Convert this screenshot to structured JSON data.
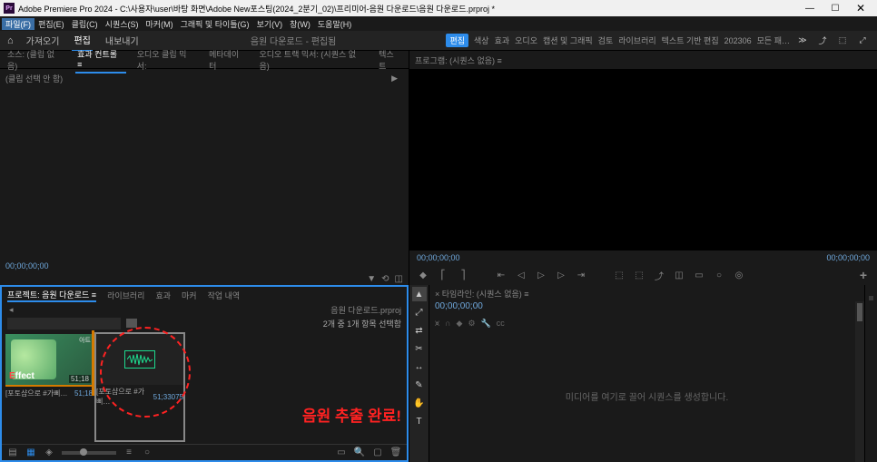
{
  "title_bar": {
    "app_icon_text": "Pr",
    "title": "Adobe Premiere Pro 2024 - C:\\사용자\\user\\바탕 화면\\Adobe New포스팅(2024_2분기_02)\\프리미어-음원 다운로드\\음원 다운로드.prproj *",
    "minimize": "—",
    "maximize": "☐",
    "close": "✕"
  },
  "menu": {
    "file": "파일(F)",
    "edit": "편집(E)",
    "clip": "클립(C)",
    "sequence": "시퀀스(S)",
    "marker": "마커(M)",
    "graphics": "그래픽 및 타이틀(G)",
    "view": "보기(V)",
    "window": "창(W)",
    "help": "도움말(H)"
  },
  "workspace": {
    "home_icon": "⌂",
    "import": "가져오기",
    "edit": "편집",
    "export": "내보내기",
    "center": "음원 다운로드 - 편집됨",
    "right_tabs": {
      "edit": "편집",
      "color": "색상",
      "effects": "효과",
      "audio": "오디오",
      "caption": "캡션 및 그래픽",
      "review": "검토",
      "library": "라이브러리",
      "text_edit": "텍스트 기반 편집",
      "date": "202306",
      "all": "모든 패…"
    }
  },
  "source": {
    "tabs": {
      "source": "소스: (클립 없음)",
      "effect_controls": "효과 컨트롤 ≡",
      "audio_mixer": "오디오 클립 믹서:",
      "metadata": "메타데이터",
      "audio_track": "오디오 트랙 믹서: (시퀀스 없음)",
      "text": "텍스트"
    },
    "no_clip": "(클립 선택 안 함)",
    "dropdown_arrow": "▶",
    "timecode": "00;00;00;00"
  },
  "project": {
    "tabs": {
      "project": "프로젝트: 음원 다운로드 ≡",
      "library": "라이브러리",
      "effects": "효과",
      "marker": "마커",
      "history": "작업 내역"
    },
    "breadcrumb": "음원 다운로드.prproj",
    "arrow_btn": "◂",
    "search_placeholder": "",
    "item_count": "2개 중 1개 항목 선택함",
    "items": [
      {
        "name": "[포토샵으로 #가삐…",
        "dur": "51;18",
        "effect_text_e": "E",
        "effect_text_rest": "ffect",
        "korean_label": "아트"
      },
      {
        "name": "[포토샵으로 #가삐…",
        "dur": "51;33075"
      }
    ],
    "annotation": "음원 추출 완료!",
    "footer_icons": {
      "list": "▤",
      "icon_small": "▦",
      "icon_large": "◫",
      "freeform": "◈",
      "sort": "≡",
      "auto": "○"
    },
    "footer_right": {
      "new_item": "▭",
      "new_bin": "▢",
      "delete": "🗑"
    }
  },
  "program": {
    "tab": "프로그램: (시퀀스 없음) ≡",
    "timecode_left": "00;00;00;00",
    "timecode_right": "00;00;00;00",
    "controls": {
      "mark_in": "⎡",
      "mark_out": "⎤",
      "go_in": "⇤",
      "step_back": "◁",
      "play": "▷",
      "step_fwd": "▷",
      "go_out": "⇥",
      "lift": "⬚",
      "extract": "⬚",
      "export": "⤴",
      "compare": "◫",
      "safe": "▭",
      "btn1": "○",
      "btn2": "◎",
      "add": "+"
    }
  },
  "tools": {
    "selection": "▲",
    "track_select": "⤢",
    "ripple": "⇄",
    "razor": "✂",
    "slip": "↔",
    "pen": "✎",
    "hand": "✋",
    "type": "T"
  },
  "timeline": {
    "tab": "× 타임라인: (시퀀스 없음) ≡",
    "timecode": "00;00;00;00",
    "empty_msg": "미디어를 여기로 끌어 시퀀스를 생성합니다."
  }
}
